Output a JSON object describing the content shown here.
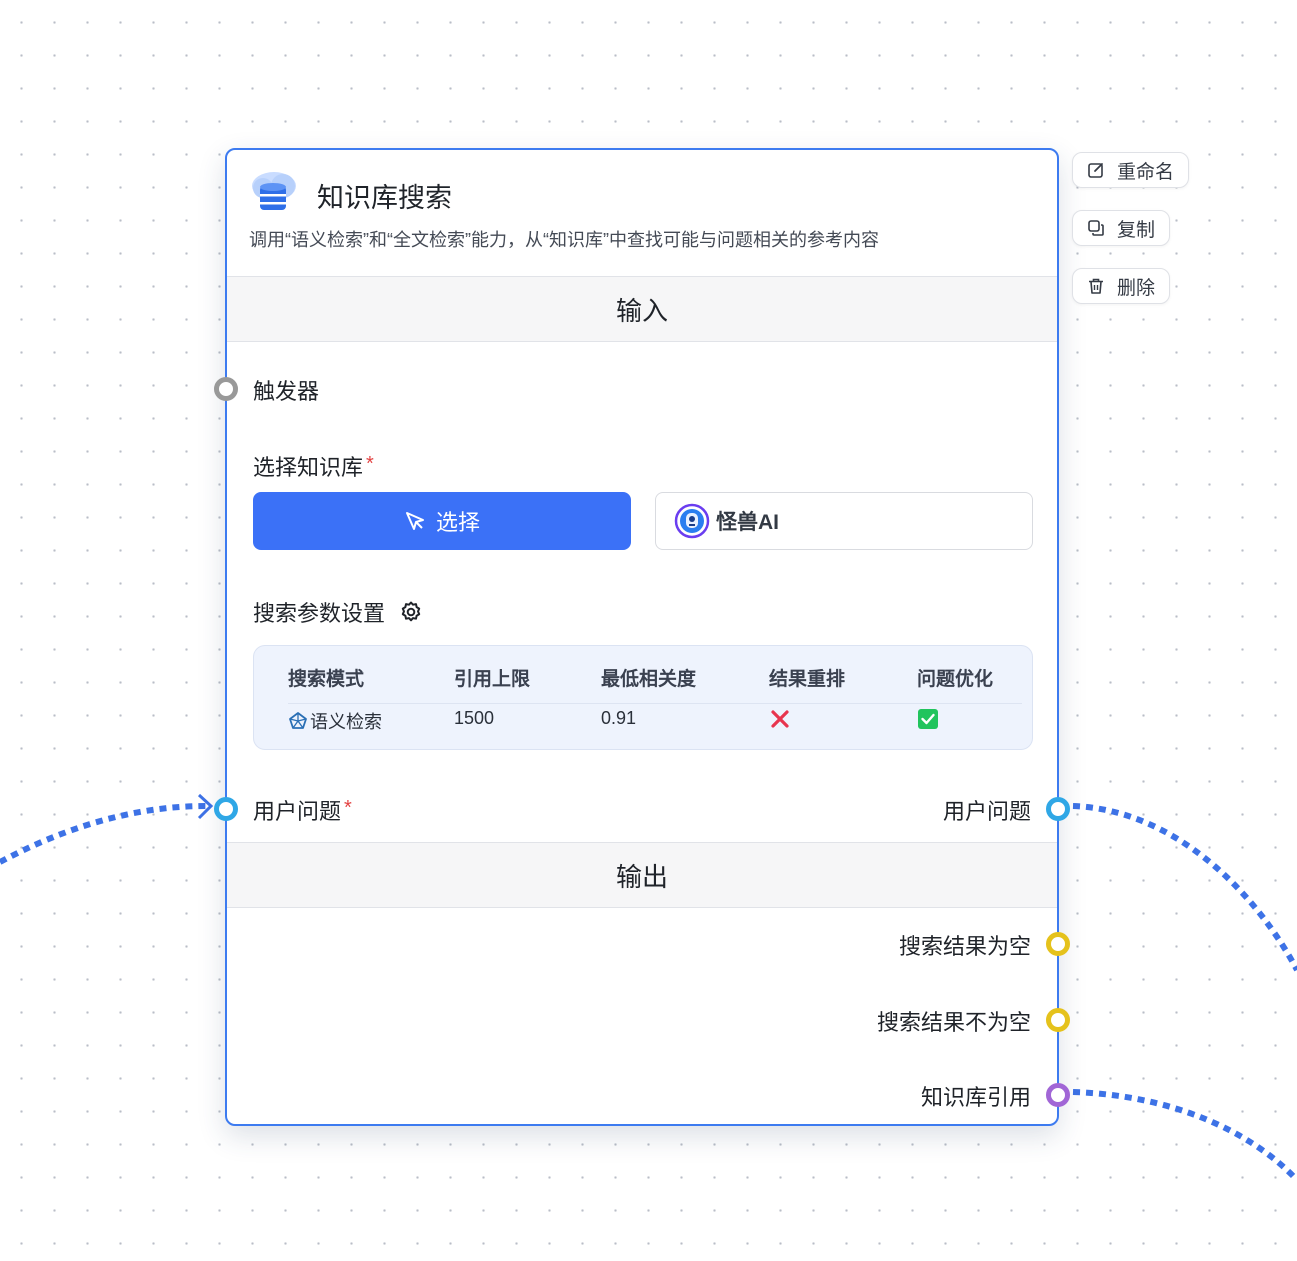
{
  "node": {
    "title": "知识库搜索",
    "description": "调用“语义检索”和“全文检索”能力，从“知识库”中查找可能与问题相关的参考内容",
    "icon": "database-cloud-icon"
  },
  "actions": {
    "rename": "重命名",
    "copy": "复制",
    "delete": "删除"
  },
  "inputs": {
    "section_title": "输入",
    "trigger_label": "触发器",
    "kb_select_label": "选择知识库",
    "required_mark": "*",
    "select_button": "选择",
    "selected_kb": "怪兽AI",
    "params_title": "搜索参数设置",
    "params_table": {
      "headers": [
        "搜索模式",
        "引用上限",
        "最低相关度",
        "结果重排",
        "问题优化"
      ],
      "row": {
        "mode": "语义检索",
        "limit": "1500",
        "min_similarity": "0.91",
        "rerank": false,
        "query_optimize": true
      }
    },
    "user_question_label": "用户问题",
    "user_question_output": "用户问题"
  },
  "outputs": {
    "section_title": "输出",
    "items": [
      "搜索结果为空",
      "搜索结果不为空",
      "知识库引用"
    ]
  },
  "colors": {
    "accent": "#3b71f7",
    "border": "#3d7bf0",
    "handle_gray": "#999999",
    "handle_blue": "#2fa7e6",
    "handle_yellow": "#e5c21c",
    "handle_purple": "#a166d6",
    "edge": "#3d72e6"
  }
}
